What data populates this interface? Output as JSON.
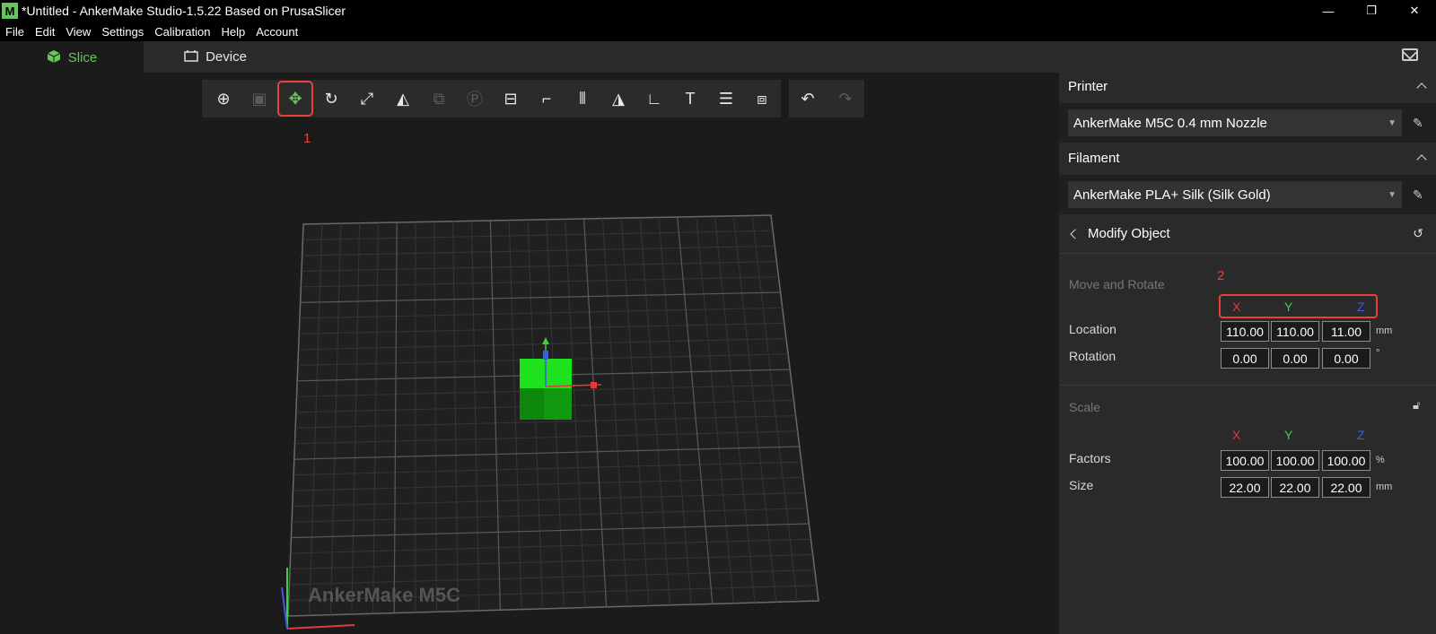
{
  "window": {
    "title": "*Untitled - AnkerMake Studio-1.5.22 Based on PrusaSlicer",
    "app_icon_letter": "M",
    "controls": [
      "—",
      "❐",
      "✕"
    ]
  },
  "menu": [
    "File",
    "Edit",
    "View",
    "Settings",
    "Calibration",
    "Help",
    "Account"
  ],
  "tabs": [
    {
      "label": "Slice",
      "icon": "cube-icon",
      "active": true
    },
    {
      "label": "Device",
      "icon": "device-icon",
      "active": false
    }
  ],
  "toolbar": {
    "tools": [
      {
        "name": "add-object",
        "glyph": "⊕",
        "state": "normal"
      },
      {
        "name": "arrange",
        "glyph": "▣",
        "state": "disabled"
      },
      {
        "name": "move",
        "glyph": "✥",
        "state": "selected"
      },
      {
        "name": "rotate",
        "glyph": "↻",
        "state": "normal"
      },
      {
        "name": "scale",
        "glyph": "⤢",
        "state": "normal"
      },
      {
        "name": "place-on-face",
        "glyph": "◭",
        "state": "normal"
      },
      {
        "name": "copy",
        "glyph": "⧉",
        "state": "disabled"
      },
      {
        "name": "paste",
        "glyph": "Ⓟ",
        "state": "disabled"
      },
      {
        "name": "cut",
        "glyph": "⊟",
        "state": "normal"
      },
      {
        "name": "gcode",
        "glyph": "⌐",
        "state": "normal"
      },
      {
        "name": "supports",
        "glyph": "⫴",
        "state": "normal"
      },
      {
        "name": "auto-orient",
        "glyph": "◮",
        "state": "normal"
      },
      {
        "name": "measure",
        "glyph": "∟",
        "state": "normal"
      },
      {
        "name": "text",
        "glyph": "T",
        "state": "normal"
      },
      {
        "name": "layers",
        "glyph": "☰",
        "state": "normal"
      },
      {
        "name": "shapes",
        "glyph": "⧈",
        "state": "normal"
      }
    ],
    "undo": "↶",
    "redo": "↷",
    "annotation_1": "1"
  },
  "bed": {
    "label": "AnkerMake M5C"
  },
  "panel": {
    "printer": {
      "heading": "Printer",
      "selected": "AnkerMake M5C 0.4 mm Nozzle"
    },
    "filament": {
      "heading": "Filament",
      "selected": "AnkerMake PLA+ Silk (Silk Gold)"
    },
    "modify": {
      "heading": "Modify Object",
      "move_rotate_label": "Move and Rotate",
      "annotation_2": "2",
      "axes": [
        "X",
        "Y",
        "Z"
      ],
      "location_label": "Location",
      "location": [
        "110.00",
        "110.00",
        "11.00"
      ],
      "location_unit": "mm",
      "rotation_label": "Rotation",
      "rotation": [
        "0.00",
        "0.00",
        "0.00"
      ],
      "rotation_unit": "°",
      "scale_label": "Scale",
      "factors_label": "Factors",
      "factors": [
        "100.00",
        "100.00",
        "100.00"
      ],
      "factors_unit": "%",
      "size_label": "Size",
      "size": [
        "22.00",
        "22.00",
        "22.00"
      ],
      "size_unit": "mm"
    }
  },
  "colors": {
    "accent": "#66c65b",
    "annotation": "#e8413b",
    "axis_x": "#e23b3b",
    "axis_y": "#3ed13e",
    "axis_z": "#3e5de0"
  }
}
